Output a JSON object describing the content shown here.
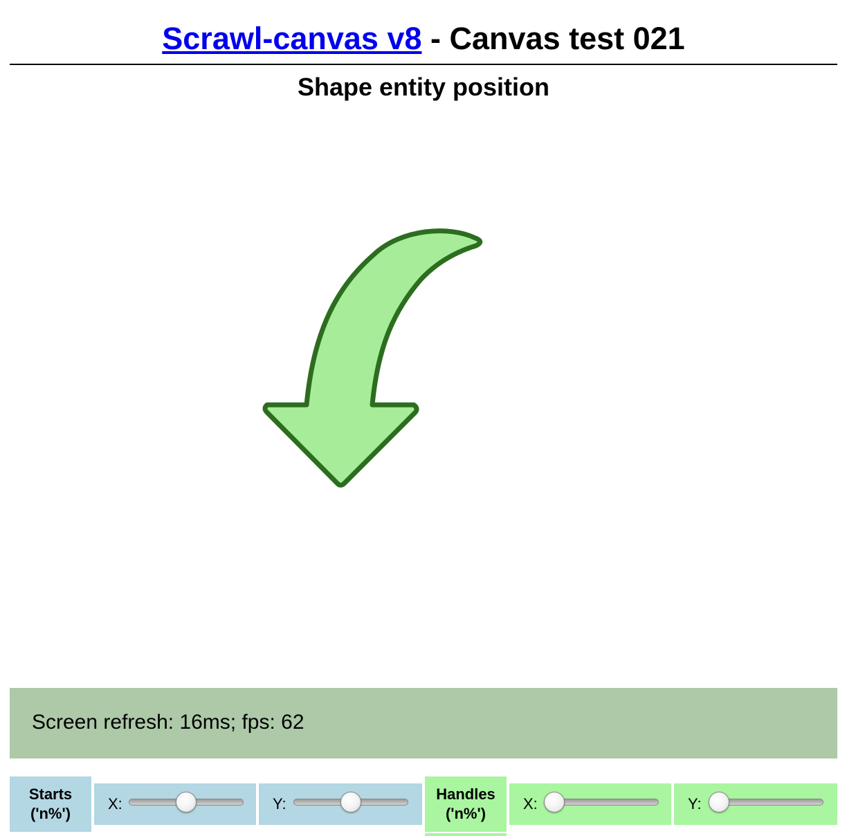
{
  "header": {
    "link_text": "Scrawl-canvas v8",
    "title_rest": " - Canvas test 021",
    "subtitle": "Shape entity position"
  },
  "canvas": {
    "arrow_fill": "#a6ec99",
    "arrow_stroke": "#2c6d1f"
  },
  "status": {
    "text": "Screen refresh: 16ms; fps: 62"
  },
  "controls": {
    "starts": {
      "label_line1": "Starts",
      "label_line2": "('n%')",
      "x_label": "X:",
      "y_label": "Y:",
      "x_value_fraction": 0.5,
      "y_value_fraction": 0.5,
      "color": "#b3d7e3"
    },
    "handles": {
      "label_line1": "Handles",
      "label_line2": "('n%')",
      "x_label": "X:",
      "y_label": "Y:",
      "x_value_fraction": 0.0,
      "y_value_fraction": 0.0,
      "color": "#a9f5a0"
    }
  }
}
